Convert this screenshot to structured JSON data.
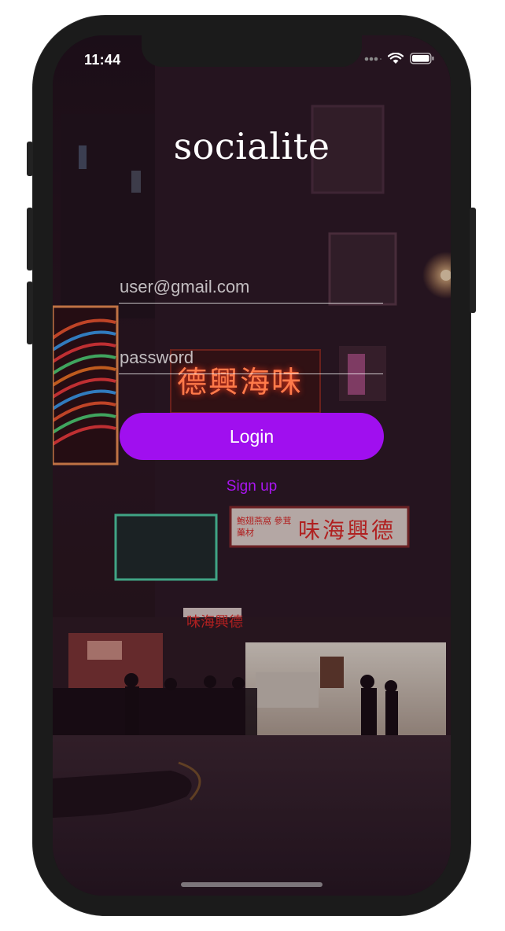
{
  "status_bar": {
    "time": "11:44",
    "icons": [
      "signal-dots-icon",
      "wifi-icon",
      "battery-icon"
    ]
  },
  "app": {
    "title": "socialite"
  },
  "login_form": {
    "email_placeholder": "user@gmail.com",
    "email_value": "",
    "password_placeholder": "password",
    "password_value": "",
    "login_label": "Login",
    "signup_label": "Sign up"
  },
  "background": {
    "description_icon": "night-street-photo",
    "signs": [
      "德興海味",
      "味海興德",
      "鮑翅燕窩 參茸藥材",
      "味海興德"
    ]
  },
  "colors": {
    "accent": "#a00fef",
    "link": "#a915f0",
    "device_frame": "#1b1b1b"
  }
}
